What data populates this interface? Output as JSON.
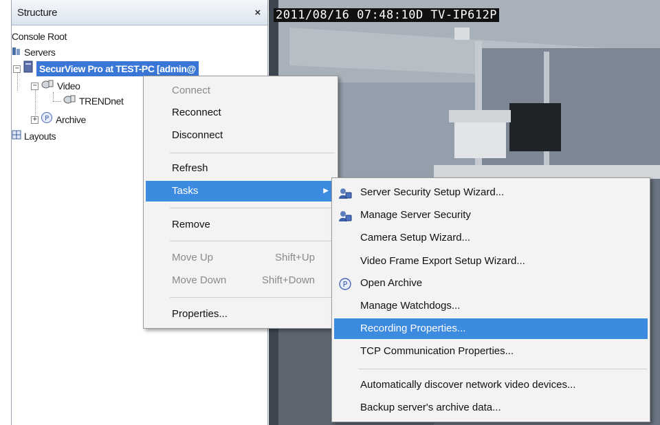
{
  "panel": {
    "title": "Structure",
    "close": "×",
    "tree": {
      "root": "Console Root",
      "servers": "Servers",
      "server": "SecurView Pro at TEST-PC [admin@",
      "video": "Video",
      "camera": "TRENDnet",
      "archive": "Archive",
      "layouts": "Layouts"
    }
  },
  "camera": {
    "osd": "2011/08/16 07:48:10D TV-IP612P"
  },
  "context_menu": {
    "connect": "Connect",
    "reconnect": "Reconnect",
    "disconnect": "Disconnect",
    "refresh": "Refresh",
    "tasks": "Tasks",
    "remove": "Remove",
    "move_up": "Move Up",
    "move_up_shortcut": "Shift+Up",
    "move_down": "Move Down",
    "move_down_shortcut": "Shift+Down",
    "properties": "Properties..."
  },
  "tasks_menu": {
    "items": [
      "Server Security Setup Wizard...",
      "Manage Server Security",
      "Camera Setup Wizard...",
      "Video Frame Export Setup Wizard...",
      "Open Archive",
      "Manage Watchdogs...",
      "Recording Properties...",
      "TCP Communication Properties...",
      "Automatically discover network video devices...",
      "Backup server's archive data..."
    ]
  },
  "colors": {
    "highlight": "#3d8be0",
    "tree_selection": "#3a76d6"
  }
}
